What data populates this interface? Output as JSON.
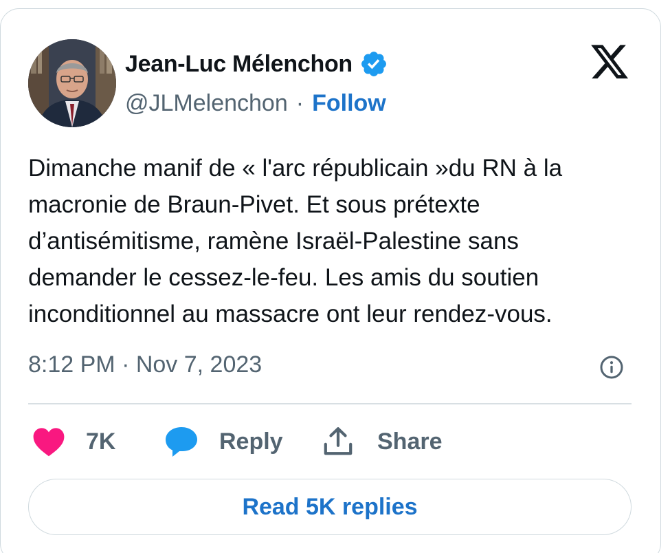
{
  "author": {
    "name": "Jean-Luc Mélenchon",
    "handle": "@JLMelenchon",
    "separator": "·",
    "follow_label": "Follow",
    "verified": true
  },
  "tweet": {
    "text": "Dimanche manif de « l'arc républicain »du RN à la\nmacronie de Braun-Pivet. Et sous prétexte\nd’antisémitisme, ramène Israël-Palestine sans\ndemander le cessez-le-feu. Les amis du soutien\ninconditionnel au massacre ont leur rendez-vous.",
    "timestamp": "8:12 PM · Nov 7, 2023"
  },
  "actions": {
    "like_count": "7K",
    "reply_label": "Reply",
    "share_label": "Share"
  },
  "read_replies_label": "Read 5K replies",
  "icons": {
    "verified": "verified-badge-icon",
    "logo": "x-logo-icon",
    "info": "info-icon",
    "like": "heart-icon",
    "reply": "speech-bubble-icon",
    "share": "share-upload-icon"
  },
  "colors": {
    "accent": "#1d73c9",
    "verified": "#1d9bf0",
    "heart": "#f91880",
    "muted": "#536471",
    "border": "#cfd9de"
  }
}
